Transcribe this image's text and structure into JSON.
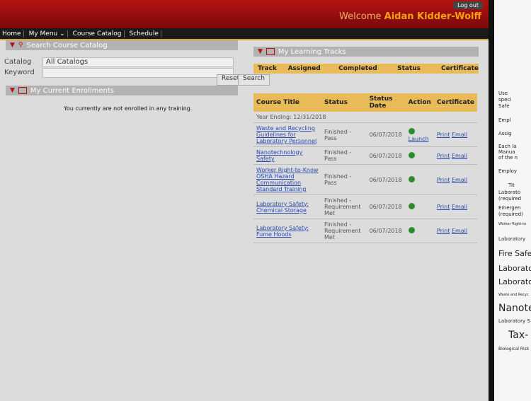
{
  "header": {
    "logout": "Log out",
    "welcome": "Welcome",
    "user": "Aidan Kidder-Wolff"
  },
  "nav": [
    "Home",
    "My Menu ⌄",
    "Course Catalog",
    "Schedule"
  ],
  "search": {
    "title": "Search Course Catalog",
    "catalog_label": "Catalog",
    "catalog_value": "All Catalogs",
    "keyword_label": "Keyword",
    "keyword_value": "",
    "reset": "Reset",
    "search": "Search"
  },
  "enrollments": {
    "title": "My Current Enrollments",
    "notice": "You currently are not enrolled in any training."
  },
  "tracks": {
    "title": "My Learning Tracks",
    "columns": [
      "Track",
      "Assigned",
      "Completed",
      "Status",
      "Certificate"
    ]
  },
  "courses": {
    "columns": [
      "Course Title",
      "Status",
      "Status Date",
      "Action",
      "Certificate"
    ],
    "year_label": "Year Ending: 12/31/2018",
    "rows": [
      {
        "title": "Waste and Recycling Guidelines for Laboratory Personnel",
        "status": "Finished - Pass",
        "date": "06/07/2018",
        "launch": "Launch",
        "print": "Print",
        "email": "Email"
      },
      {
        "title": "Nanotechnology Safety",
        "status": "Finished - Pass",
        "date": "06/07/2018",
        "launch": "",
        "print": "Print",
        "email": "Email"
      },
      {
        "title": "Worker Right-to-Know OSHA Hazard Communication Standard Training",
        "status": "Finished - Pass",
        "date": "06/07/2018",
        "launch": "",
        "print": "Print",
        "email": "Email"
      },
      {
        "title": "Laboratory Safety: Chemical Storage",
        "status": "Finished - Requirement Met",
        "date": "06/07/2018",
        "launch": "",
        "print": "Print",
        "email": "Email"
      },
      {
        "title": "Laboratory Safety: Fume Hoods",
        "status": "Finished - Requirement Met",
        "date": "06/07/2018",
        "launch": "",
        "print": "Print",
        "email": "Email"
      }
    ]
  },
  "side": [
    "Use",
    "speci",
    "Safe",
    "Empl",
    "Assig",
    "Each la",
    "Manua",
    "of the n",
    "Employ",
    "Tit",
    "Laborato",
    "(required",
    "Emergen",
    "(required)",
    "Worker Right-to",
    "Laboratory",
    "Fire Safet",
    "Laborator",
    "Laborato",
    "Waste and Recyc",
    "Nanote",
    "Laboratory S",
    "Tax-",
    "Biological Risk"
  ]
}
